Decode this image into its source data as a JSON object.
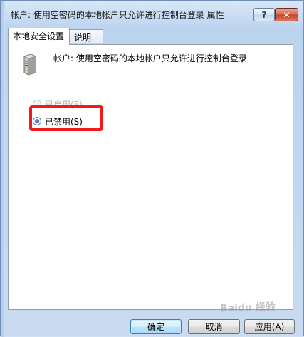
{
  "window": {
    "title": "帐户: 使用空密码的本地帐户只允许进行控制台登录 属性",
    "help_label": "?",
    "close_label": "✕"
  },
  "tabs": [
    {
      "label": "本地安全设置",
      "active": true
    },
    {
      "label": "说明",
      "active": false
    }
  ],
  "policy": {
    "icon": "server-icon",
    "name": "帐户: 使用空密码的本地帐户只允许进行控制台登录"
  },
  "options": {
    "enabled": {
      "label": "已启用(E)",
      "checked": false
    },
    "disabled": {
      "label": "已禁用(S)",
      "checked": true
    }
  },
  "buttons": {
    "ok": "确定",
    "cancel": "取消",
    "apply": "应用(A)"
  },
  "watermark": "Baidu 经验",
  "colors": {
    "highlight": "#f01a1a",
    "title_close": "#c7412a"
  }
}
